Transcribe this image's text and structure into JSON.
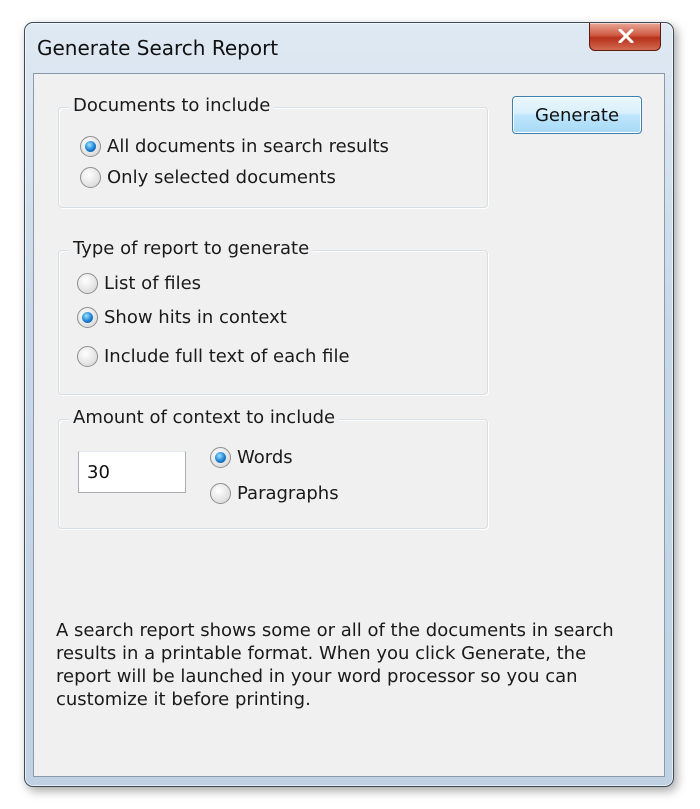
{
  "window": {
    "title": "Generate Search Report",
    "close_label": "×"
  },
  "documents_group": {
    "legend": "Documents to include",
    "options": [
      {
        "label": "All documents in search results",
        "checked": true
      },
      {
        "label": "Only selected documents",
        "checked": false
      }
    ]
  },
  "report_type_group": {
    "legend": "Type of report to generate",
    "options": [
      {
        "label": "List of files",
        "checked": false
      },
      {
        "label": "Show hits in context",
        "checked": true
      },
      {
        "label": "Include full text of each file",
        "checked": false
      }
    ]
  },
  "context_group": {
    "legend": "Amount of context to include",
    "amount_value": "30",
    "options": [
      {
        "label": "Words",
        "checked": true
      },
      {
        "label": "Paragraphs",
        "checked": false
      }
    ]
  },
  "generate_button": {
    "label": "Generate"
  },
  "description": "A search report shows some or all of the documents in search results in a printable format.  When you click Generate, the report will be launched in your word processor so you can customize it before printing."
}
